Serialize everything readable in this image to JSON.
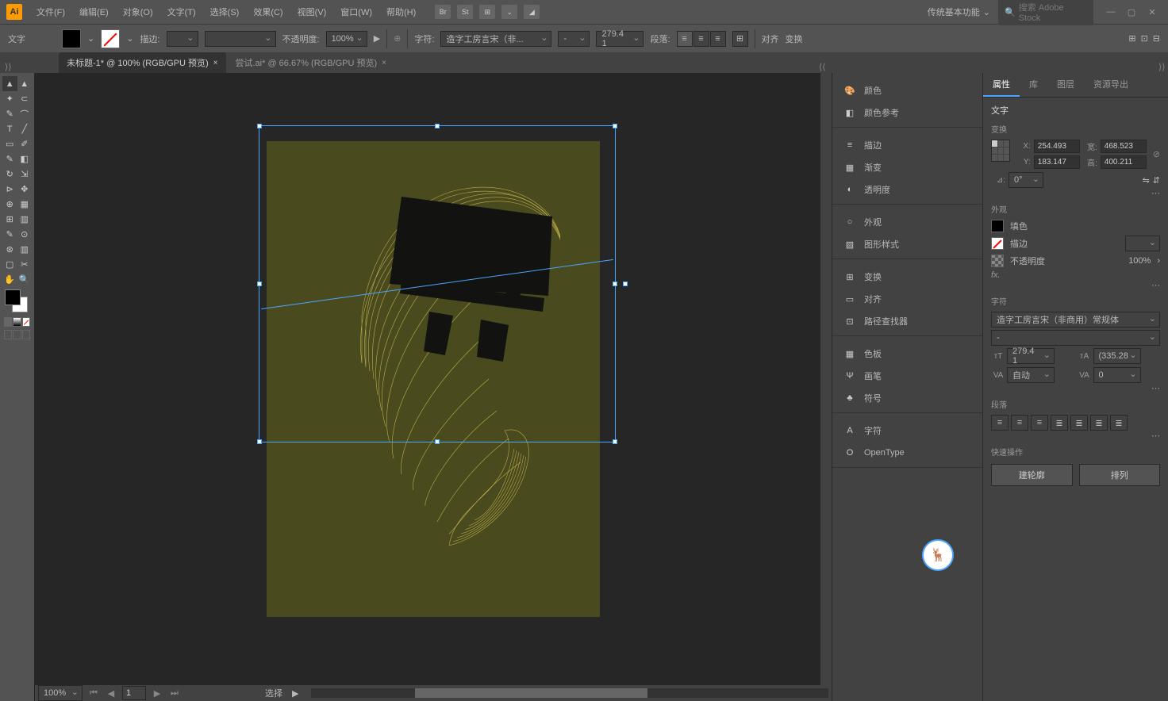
{
  "app": {
    "name": "Ai"
  },
  "menu": [
    "文件(F)",
    "编辑(E)",
    "对象(O)",
    "文字(T)",
    "选择(S)",
    "效果(C)",
    "视图(V)",
    "窗口(W)",
    "帮助(H)"
  ],
  "titlebarIcons": [
    "Br",
    "St",
    "⊞",
    "⌄",
    "◢"
  ],
  "workspaceDropdown": "传统基本功能",
  "searchPlaceholder": "搜索 Adobe Stock",
  "optionsBar": {
    "label": "文字",
    "strokeLabel": "描边:",
    "strokeWeight": "",
    "opacityLabel": "不透明度:",
    "opacity": "100%",
    "charLabel": "字符:",
    "font": "造字工房言宋（非...",
    "style": "-",
    "size": "279.4 1",
    "paraLabel": "段落:",
    "alignLabel": "对齐",
    "transformLabel": "变换"
  },
  "tabs": [
    {
      "name": "未标题-1* @ 100% (RGB/GPU 预览)",
      "active": true
    },
    {
      "name": "尝试.ai* @ 66.67% (RGB/GPU 预览)",
      "active": false
    }
  ],
  "canvasBottom": {
    "zoom": "100%",
    "artboard": "1",
    "status": "选择"
  },
  "iconPanelGroups": [
    [
      {
        "icon": "🎨",
        "label": "颜色"
      },
      {
        "icon": "◧",
        "label": "颜色参考"
      }
    ],
    [
      {
        "icon": "≡",
        "label": "描边"
      },
      {
        "icon": "▦",
        "label": "渐变"
      },
      {
        "icon": "◐",
        "label": "透明度"
      }
    ],
    [
      {
        "icon": "○",
        "label": "外观"
      },
      {
        "icon": "▧",
        "label": "图形样式"
      }
    ],
    [
      {
        "icon": "⊞",
        "label": "变换"
      },
      {
        "icon": "▭",
        "label": "对齐"
      },
      {
        "icon": "⊡",
        "label": "路径查找器"
      }
    ],
    [
      {
        "icon": "▦",
        "label": "色板"
      },
      {
        "icon": "Ψ",
        "label": "画笔"
      },
      {
        "icon": "♣",
        "label": "符号"
      }
    ],
    [
      {
        "icon": "A",
        "label": "字符"
      },
      {
        "icon": "O",
        "label": "OpenType"
      }
    ]
  ],
  "rightTabs": [
    "属性",
    "库",
    "图层",
    "资源导出"
  ],
  "properties": {
    "objectType": "文字",
    "sections": {
      "transform": "变换",
      "appearance": "外观",
      "character": "字符",
      "paragraph": "段落",
      "quickActions": "快速操作"
    },
    "transform": {
      "xLabel": "X:",
      "x": "254.493",
      "yLabel": "Y:",
      "y": "183.147",
      "wLabel": "宽:",
      "w": "468.523",
      "hLabel": "高:",
      "h": "400.211",
      "angleLabel": "⊿:",
      "angle": "0°"
    },
    "appearance": {
      "fillLabel": "填色",
      "strokeLabel": "描边",
      "opacityLabel": "不透明度",
      "opacity": "100%",
      "fx": "fx."
    },
    "character": {
      "font": "造字工房言宋（非商用）常规体",
      "style": "-",
      "size": "279.4 1",
      "leading": "(335.28",
      "kerning": "自动",
      "tracking": "0"
    },
    "quickActions": {
      "outline": "建轮廓",
      "arrange": "排列"
    }
  }
}
